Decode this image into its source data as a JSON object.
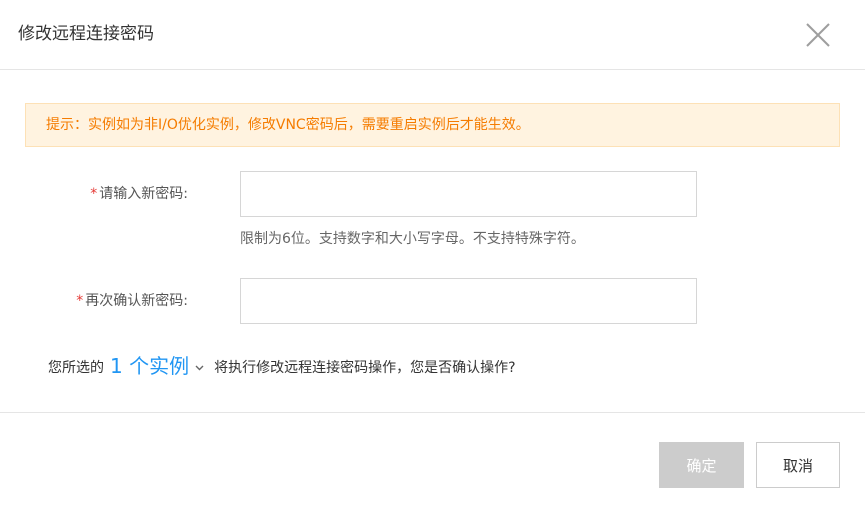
{
  "dialog": {
    "title": "修改远程连接密码",
    "close_icon": "close-icon"
  },
  "notice": {
    "text": "提示：实例如为非I/O优化实例，修改VNC密码后，需要重启实例后才能生效。"
  },
  "form": {
    "new_password": {
      "required_mark": "*",
      "label": "请输入新密码:",
      "value": "",
      "hint": "限制为6位。支持数字和大小写字母。不支持特殊字符。"
    },
    "confirm_password": {
      "required_mark": "*",
      "label": "再次确认新密码:",
      "value": ""
    }
  },
  "confirm": {
    "prefix": "您所选的",
    "instance_count_label": "1 个实例",
    "chevron_icon": "chevron-down-icon",
    "suffix": "将执行修改远程连接密码操作，您是否确认操作?"
  },
  "footer": {
    "ok_label": "确定",
    "cancel_label": "取消"
  },
  "colors": {
    "notice_text": "#f57c00",
    "notice_bg": "#fff3e0",
    "link": "#2196f3",
    "required": "#e53935",
    "ok_disabled_bg": "#cccccc"
  }
}
